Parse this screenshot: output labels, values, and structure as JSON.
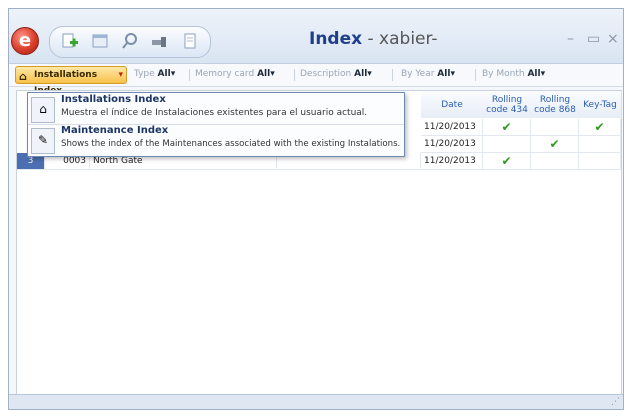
{
  "window": {
    "title_main": "Index",
    "title_sep": " - ",
    "title_user": "xabier-",
    "minimize_icon": "minimize-icon",
    "maximize_icon": "maximize-icon",
    "close_icon": "close-icon"
  },
  "app_orb_icon": "app-logo-icon",
  "quick_access": [
    "add-icon",
    "window-icon",
    "search-icon",
    "tools-icon",
    "document-icon"
  ],
  "ribbon": {
    "menu_button": "Installations Index",
    "filters": [
      {
        "label": "Type",
        "value": "All"
      },
      {
        "label": "Memory card",
        "value": "All"
      },
      {
        "label": "Description",
        "value": "All"
      },
      {
        "label": "By Year",
        "value": "All"
      },
      {
        "label": "By Month",
        "value": "All"
      }
    ]
  },
  "dropdown": {
    "items": [
      {
        "title": "Installations Index",
        "desc": "Muestra el índice de Instalaciones existentes para el usuario actual.",
        "icon": "house-icon"
      },
      {
        "title": "Maintenance Index",
        "desc": "Shows the index of the Maintenances associated with the existing Instalations.",
        "icon": "maintenance-icon"
      }
    ]
  },
  "grid": {
    "columns": [
      "Date",
      "Rolling code 434",
      "Rolling code 868",
      "Key-Tag"
    ],
    "rows": [
      {
        "num": "",
        "code": "",
        "name": "",
        "date": "11/20/2013",
        "r434": "✔",
        "r868": "",
        "key": "✔"
      },
      {
        "num": "",
        "code": "",
        "name": "",
        "date": "11/20/2013",
        "r434": "",
        "r868": "✔",
        "key": ""
      },
      {
        "num": "3",
        "code": "0003",
        "name": "North Gate",
        "date": "11/20/2013",
        "r434": "✔",
        "r868": "",
        "key": ""
      }
    ]
  },
  "colors": {
    "accent": "#f7c04a",
    "header_text": "#2a5db0",
    "check": "#2c9a1e",
    "row_num": "#4b6fb0"
  }
}
